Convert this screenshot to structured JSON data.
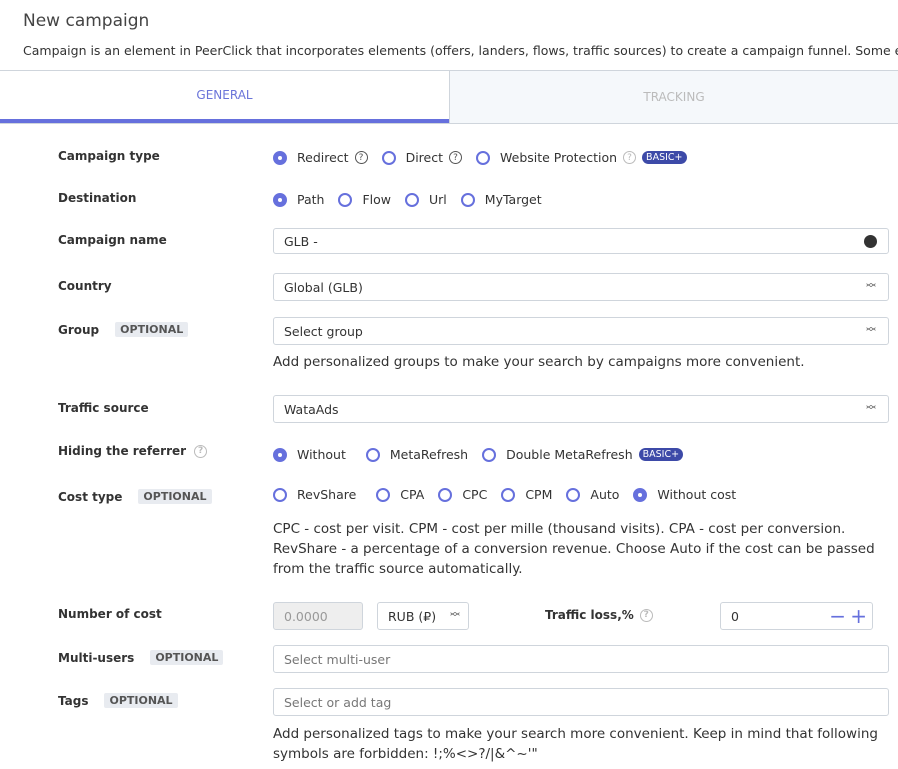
{
  "header": {
    "title": "New campaign",
    "description": "Campaign is an element in PeerClick that incorporates elements (offers, landers, flows, traffic sources) to create a campaign funnel. Some e"
  },
  "tabs": [
    {
      "label": "GENERAL"
    },
    {
      "label": "TRACKING"
    }
  ],
  "optional": "OPTIONAL",
  "badge": "BASIC+",
  "campaign_type": {
    "label": "Campaign type",
    "options": [
      "Redirect",
      "Direct",
      "Website Protection"
    ],
    "selected": "Redirect"
  },
  "destination": {
    "label": "Destination",
    "options": [
      "Path",
      "Flow",
      "Url",
      "MyTarget"
    ],
    "selected": "Path"
  },
  "campaign_name": {
    "label": "Campaign name",
    "value": "GLB -"
  },
  "country": {
    "label": "Country",
    "value": "Global (GLB)"
  },
  "group": {
    "label": "Group",
    "placeholder": "Select group",
    "help": "Add personalized groups to make your search by campaigns more convenient."
  },
  "traffic_source": {
    "label": "Traffic source",
    "value": "WataAds"
  },
  "hiding_referrer": {
    "label": "Hiding the referrer",
    "options": [
      "Without",
      "MetaRefresh",
      "Double MetaRefresh"
    ],
    "selected": "Without"
  },
  "cost_type": {
    "label": "Cost type",
    "options": [
      "RevShare",
      "CPA",
      "CPC",
      "CPM",
      "Auto",
      "Without cost"
    ],
    "selected": "Without cost",
    "help": "CPC - cost per visit. CPM - cost per mille (thousand visits). CPA - cost per conversion. RevShare - a percentage of a conversion revenue. Choose Auto if the cost can be passed from the traffic source automatically."
  },
  "number_of_cost": {
    "label": "Number of cost",
    "value": "0.0000",
    "currency": "RUB (₽)"
  },
  "traffic_loss": {
    "label": "Traffic loss,%",
    "value": "0"
  },
  "multi_users": {
    "label": "Multi-users",
    "placeholder": "Select multi-user"
  },
  "tags": {
    "label": "Tags",
    "placeholder": "Select or add tag",
    "help": "Add personalized tags to make your search more convenient. Keep in mind that following symbols are forbidden: !;%<>?/|&^~'\""
  },
  "colors": {
    "accent": "#6670dd",
    "badge": "#3d4aa8"
  }
}
